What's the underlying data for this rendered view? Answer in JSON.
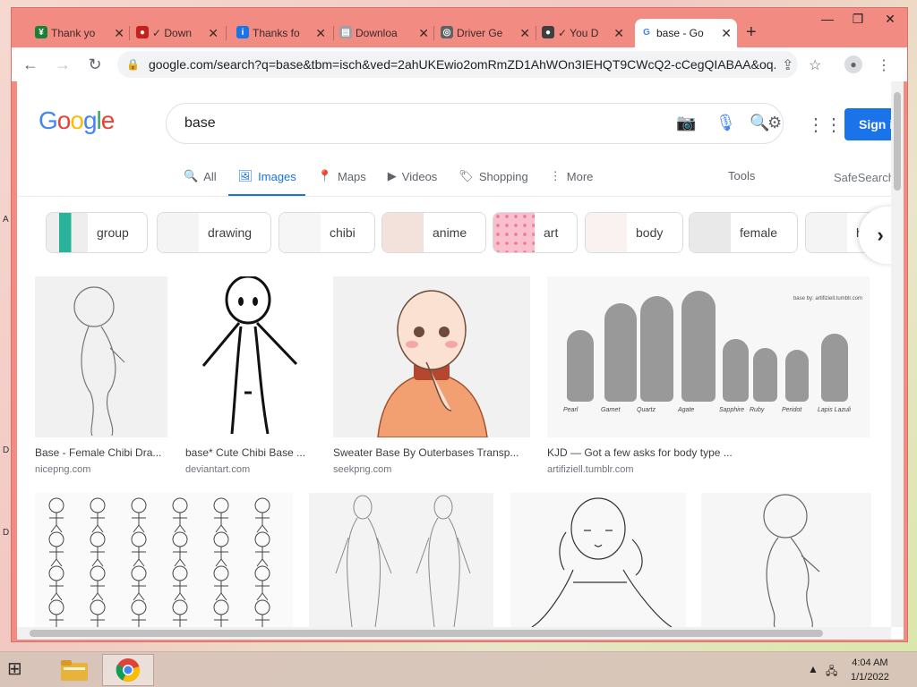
{
  "desktop": {
    "edge_letters": [
      "A",
      "D",
      "D"
    ]
  },
  "tabs": [
    {
      "title": "Thank yo",
      "fav_color": "#188038",
      "fav_glyph": "¥"
    },
    {
      "title": "✓ Down",
      "fav_color": "#c5221f",
      "fav_glyph": "●"
    },
    {
      "title": "Thanks fo",
      "fav_color": "#1a73e8",
      "fav_glyph": "i"
    },
    {
      "title": "Downloa",
      "fav_color": "#9aa0a6",
      "fav_glyph": "▤"
    },
    {
      "title": "Driver Ge",
      "fav_color": "#5f6368",
      "fav_glyph": "◎"
    },
    {
      "title": "✓ You D",
      "fav_color": "#3c4043",
      "fav_glyph": "●"
    },
    {
      "title": "base - Go",
      "fav_color": "#4285f4",
      "fav_glyph": "G"
    }
  ],
  "window_controls": [
    "—",
    "❐",
    "✕"
  ],
  "newtab_label": "+",
  "address": {
    "url": "google.com/search?q=base&tbm=isch&ved=2ahUKEwio2omRmZD1AhWOn3IEHQT9CWcQ2-cCegQIABAA&oq..."
  },
  "google": {
    "logo": "Google",
    "query": "base",
    "signin": "Sign i",
    "nav": [
      {
        "label": "All",
        "icon": "🔍"
      },
      {
        "label": "Images",
        "icon": "🖼"
      },
      {
        "label": "Maps",
        "icon": "📍"
      },
      {
        "label": "Videos",
        "icon": "▶"
      },
      {
        "label": "Shopping",
        "icon": "🏷"
      },
      {
        "label": "More",
        "icon": "⋮"
      }
    ],
    "tools": "Tools",
    "safesearch": "SafeSearch",
    "chips": [
      {
        "label": "group",
        "color": "#2bb29b"
      },
      {
        "label": "drawing",
        "color": "#e8e8e8"
      },
      {
        "label": "chibi",
        "color": "#eeeeee"
      },
      {
        "label": "anime",
        "color": "#f3d6d0"
      },
      {
        "label": "art",
        "color": "#f4a6b8"
      },
      {
        "label": "body",
        "color": "#f7eeee"
      },
      {
        "label": "female",
        "color": "#dddddd"
      },
      {
        "label": "h",
        "color": "#eeeeee"
      }
    ],
    "results_row1": [
      {
        "caption": "Base - Female Chibi Dra...",
        "source": "nicepng.com"
      },
      {
        "caption": "base* Cute Chibi Base ...",
        "source": "deviantart.com"
      },
      {
        "caption": "Sweater Base By Outerbases Transp...",
        "source": "seekpng.com"
      },
      {
        "caption": "KJD — Got a few asks for body type ...",
        "source": "artifiziell.tumblr.com"
      }
    ],
    "figure_names": [
      "Pearl",
      "Garnet",
      "Quartz",
      "Agate",
      "Sapphire",
      "Ruby",
      "Peridot",
      "Lapis Lazuli"
    ],
    "figure_credit": "base by: artifiziell.tumblr.com"
  },
  "taskbar": {
    "time": "4:04 AM",
    "date": "1/1/2022"
  }
}
